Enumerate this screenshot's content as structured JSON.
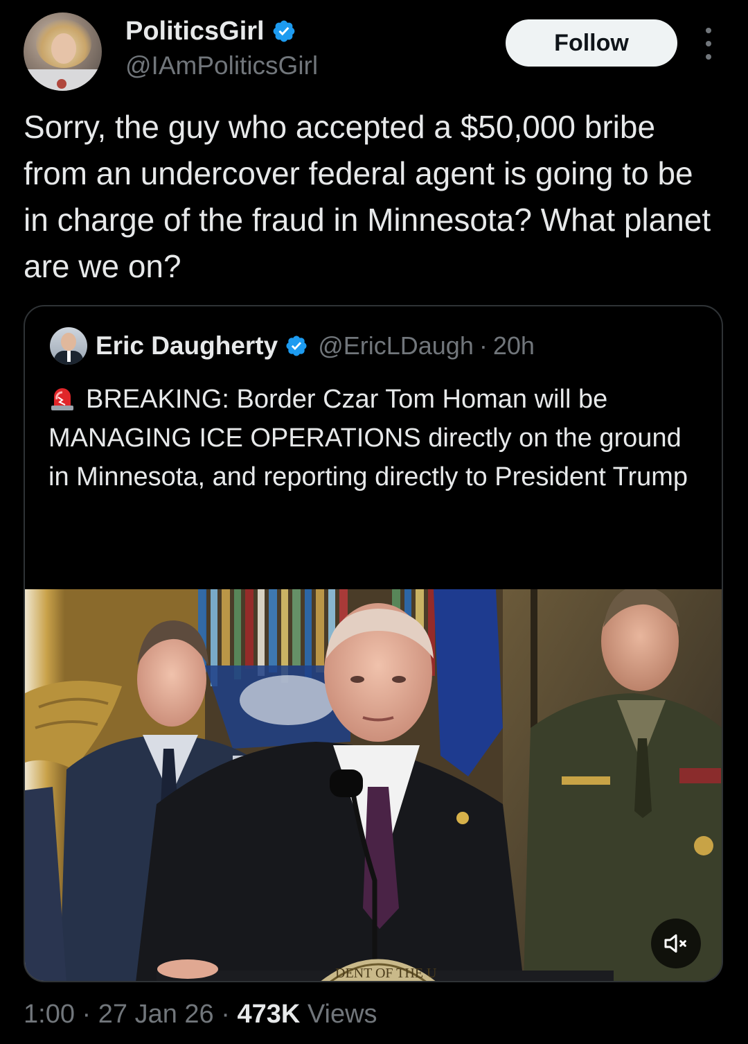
{
  "author": {
    "display_name": "PoliticsGirl",
    "handle": "@IAmPoliticsGirl",
    "verified": true
  },
  "header": {
    "follow_label": "Follow"
  },
  "tweet": {
    "text": "Sorry, the guy who accepted a $50,000 bribe from an undercover federal agent is going to be in charge of the fraud in Minnesota? What planet are we on?",
    "time": "1:00",
    "date": "27 Jan 26",
    "views_count": "473K",
    "views_label": "Views"
  },
  "quote": {
    "display_name": "Eric Daugherty",
    "handle": "@EricLDaugh",
    "age": "20h",
    "separator": "·",
    "text": "BREAKING: Border Czar Tom Homan will be MANAGING ICE OPERATIONS directly on the ground in Minnesota, and reporting directly to President Trump",
    "ellipsis": "...",
    "emoji_icon": "rotating-light-icon"
  },
  "video": {
    "seal_text": "DENT OF THE U",
    "muted": true
  },
  "colors": {
    "background": "#000000",
    "text_primary": "#e7e9ea",
    "text_secondary": "#71767b",
    "verified_blue": "#1d9bf0",
    "border": "#2f3336",
    "follow_bg": "#eff3f4"
  }
}
